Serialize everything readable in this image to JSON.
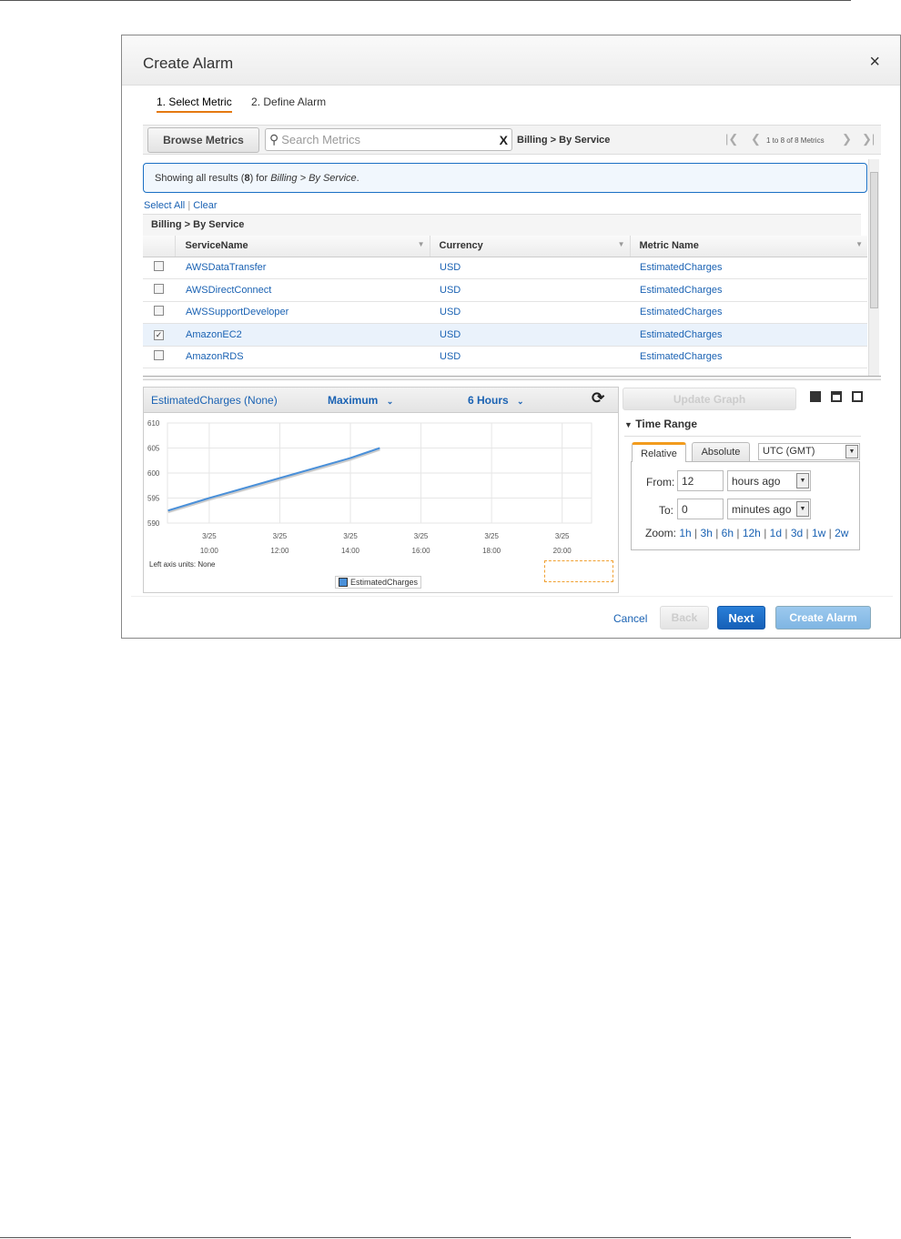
{
  "dialog": {
    "title": "Create Alarm",
    "close": "×"
  },
  "steps": [
    "1. Select Metric",
    "2. Define Alarm"
  ],
  "toolbar": {
    "browse": "Browse Metrics",
    "search_placeholder": "Search Metrics",
    "clear": "X",
    "breadcrumb": "Billing > By Service",
    "paging": "1 to 8 of 8 Metrics"
  },
  "info": {
    "prefix": "Showing all results (",
    "count": "8",
    "mid": ") for ",
    "path": "Billing > By Service",
    "suffix": "."
  },
  "select_all": "Select All",
  "clear": "Clear",
  "group": "Billing > By Service",
  "columns": [
    "ServiceName",
    "Currency",
    "Metric Name"
  ],
  "rows": [
    {
      "service": "AWSDataTransfer",
      "currency": "USD",
      "metric": "EstimatedCharges",
      "checked": false
    },
    {
      "service": "AWSDirectConnect",
      "currency": "USD",
      "metric": "EstimatedCharges",
      "checked": false
    },
    {
      "service": "AWSSupportDeveloper",
      "currency": "USD",
      "metric": "EstimatedCharges",
      "checked": false
    },
    {
      "service": "AmazonEC2",
      "currency": "USD",
      "metric": "EstimatedCharges",
      "checked": true
    },
    {
      "service": "AmazonRDS",
      "currency": "USD",
      "metric": "EstimatedCharges",
      "checked": false
    }
  ],
  "graph": {
    "title": "EstimatedCharges (None)",
    "stat": "Maximum",
    "period": "6 Hours",
    "units": "Left axis units:  None",
    "legend": "EstimatedCharges"
  },
  "chart_data": {
    "type": "line",
    "ylim": [
      590,
      610
    ],
    "yticks": [
      "610",
      "605",
      "600",
      "595",
      "590"
    ],
    "xticks": [
      [
        "3/25",
        "10:00"
      ],
      [
        "3/25",
        "12:00"
      ],
      [
        "3/25",
        "14:00"
      ],
      [
        "3/25",
        "16:00"
      ],
      [
        "3/25",
        "18:00"
      ],
      [
        "3/25",
        "20:00"
      ]
    ],
    "series": [
      {
        "name": "EstimatedCharges",
        "color": "#4a90d9",
        "x": [
          "08:50",
          "10:00",
          "12:00",
          "14:00",
          "14:50"
        ],
        "y": [
          592.5,
          595,
          599,
          603,
          605
        ]
      }
    ],
    "grid": true,
    "legend": "bottom"
  },
  "side": {
    "update": "Update Graph",
    "time_range": "Time Range",
    "tabs": [
      "Relative",
      "Absolute"
    ],
    "tz": "UTC (GMT)",
    "from_label": "From:",
    "from_val": "12",
    "from_unit": "hours ago",
    "to_label": "To:",
    "to_val": "0",
    "to_unit": "minutes ago",
    "zoom_label": "Zoom:",
    "zooms": [
      "1h",
      "3h",
      "6h",
      "12h",
      "1d",
      "3d",
      "1w",
      "2w"
    ]
  },
  "footer": {
    "cancel": "Cancel",
    "back": "Back",
    "next": "Next",
    "create": "Create Alarm"
  }
}
